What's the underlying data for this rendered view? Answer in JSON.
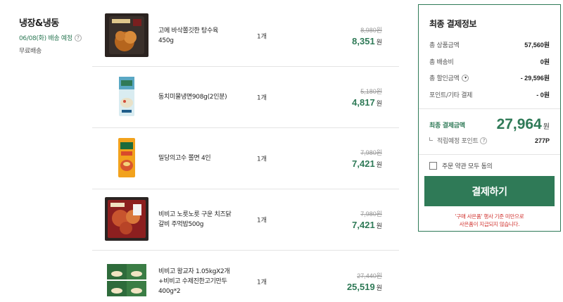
{
  "group": {
    "title": "냉장&냉동",
    "delivery_date": "06/08(화) 배송 예정",
    "shipping": "무료배송"
  },
  "items": [
    {
      "name": "고메 바삭쫄깃한 탕수육 450g",
      "qty": "1개",
      "original_price": "8,980원",
      "final_price": "8,351",
      "currency": "원"
    },
    {
      "name": "동치미물냉면908g(2인분)",
      "qty": "1개",
      "original_price": "5,180원",
      "final_price": "4,817",
      "currency": "원"
    },
    {
      "name": "밀당의고수 쫄면 4인",
      "qty": "1개",
      "original_price": "7,980원",
      "final_price": "7,421",
      "currency": "원"
    },
    {
      "name": "비비고 노릇노릇 구운 치즈닭갈비 주먹밥500g",
      "qty": "1개",
      "original_price": "7,980원",
      "final_price": "7,421",
      "currency": "원"
    },
    {
      "name": "비비고 왕교자 1.05kgX2개+비비고 수제진한고기만두400g*2",
      "qty": "1개",
      "original_price": "27,440원",
      "final_price": "25,519",
      "currency": "원"
    }
  ],
  "summary": {
    "title": "최종 결제정보",
    "rows": [
      {
        "label": "총 상품금액",
        "value": "57,560원"
      },
      {
        "label": "총 배송비",
        "value": "0원"
      },
      {
        "label": "총 할인금액",
        "value": "- 29,596원"
      },
      {
        "label": "포인트/기타 결제",
        "value": "- 0원"
      }
    ],
    "total_label": "최종 결제금액",
    "total_value": "27,964",
    "total_currency": "원",
    "points_label": "적립예정 포인트",
    "points_value": "277P",
    "agree_label": "주문 약관 모두 동의",
    "pay_button": "결제하기",
    "notice_line1": "'구매 사은품' 행사 기준 미만으로",
    "notice_line2": "사은품이 지급되지 않습니다.",
    "help_glyph": "?",
    "dropdown_glyph": "▾"
  },
  "colors": {
    "accent": "#2f7a57",
    "notice": "#d0312d"
  }
}
